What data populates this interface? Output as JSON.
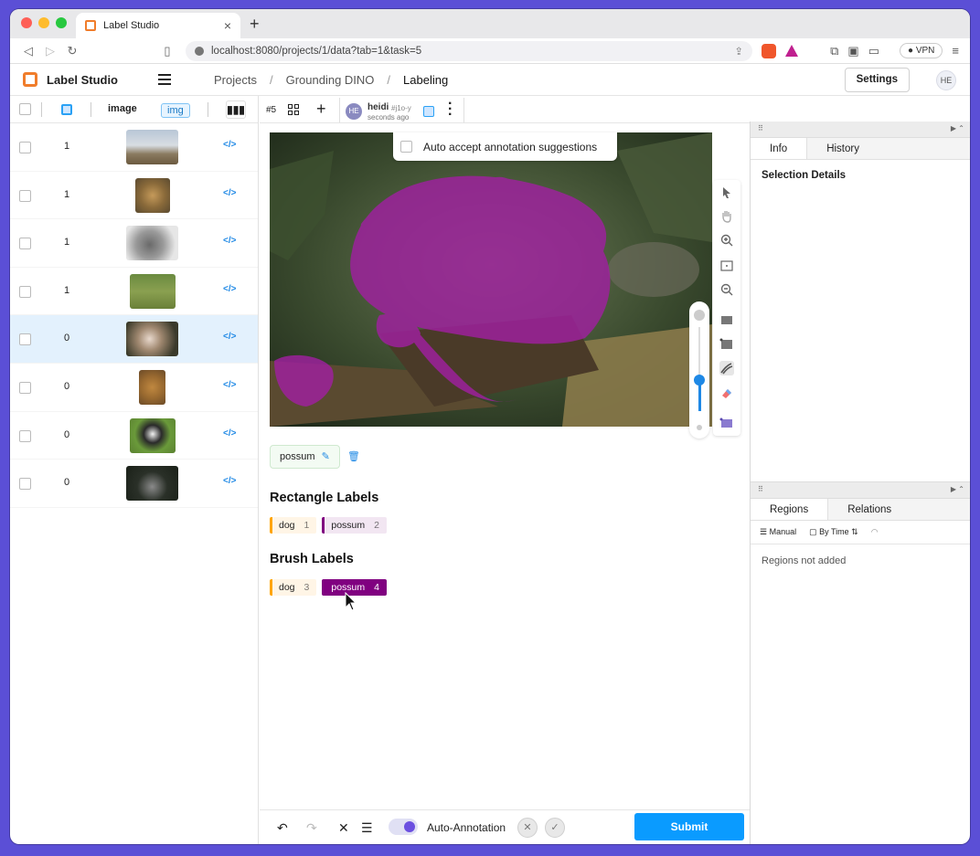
{
  "browser": {
    "tab_title": "Label Studio",
    "url": "localhost:8080/projects/1/data?tab=1&task=5",
    "vpn_label": "VPN"
  },
  "app": {
    "brand": "Label Studio",
    "breadcrumbs": [
      "Projects",
      "Grounding DINO",
      "Labeling"
    ],
    "settings_label": "Settings",
    "user_initials": "HE"
  },
  "datamanager": {
    "image_column": "image",
    "img_tag": "img",
    "rows": [
      {
        "count": "1",
        "selected": false
      },
      {
        "count": "1",
        "selected": false
      },
      {
        "count": "1",
        "selected": false
      },
      {
        "count": "1",
        "selected": false
      },
      {
        "count": "0",
        "selected": true
      },
      {
        "count": "0",
        "selected": false
      },
      {
        "count": "0",
        "selected": false
      },
      {
        "count": "0",
        "selected": false
      }
    ],
    "code_glyph": "</>"
  },
  "annotation": {
    "task_number": "#5",
    "annotator_initials": "HE",
    "annotator_name": "heidi",
    "annotation_id": "#j1o-y",
    "time_ago": "seconds ago",
    "auto_accept_label": "Auto accept annotation suggestions",
    "region_label": "possum",
    "rectangle_labels_title": "Rectangle Labels",
    "rectangle_labels": [
      {
        "name": "dog",
        "hotkey": "1"
      },
      {
        "name": "possum",
        "hotkey": "2"
      }
    ],
    "brush_labels_title": "Brush Labels",
    "brush_labels": [
      {
        "name": "dog",
        "hotkey": "3"
      },
      {
        "name": "possum",
        "hotkey": "4"
      }
    ],
    "auto_annotation_label": "Auto-Annotation",
    "submit_label": "Submit"
  },
  "sidebar": {
    "tabs": [
      "Info",
      "History"
    ],
    "selection_details": "Selection Details",
    "region_tabs": [
      "Regions",
      "Relations"
    ],
    "manual_label": "Manual",
    "by_time_label": "By Time",
    "regions_empty": "Regions not added"
  },
  "colors": {
    "dog": "#ffa500",
    "possum": "#800080",
    "accent": "#0a9bff"
  }
}
